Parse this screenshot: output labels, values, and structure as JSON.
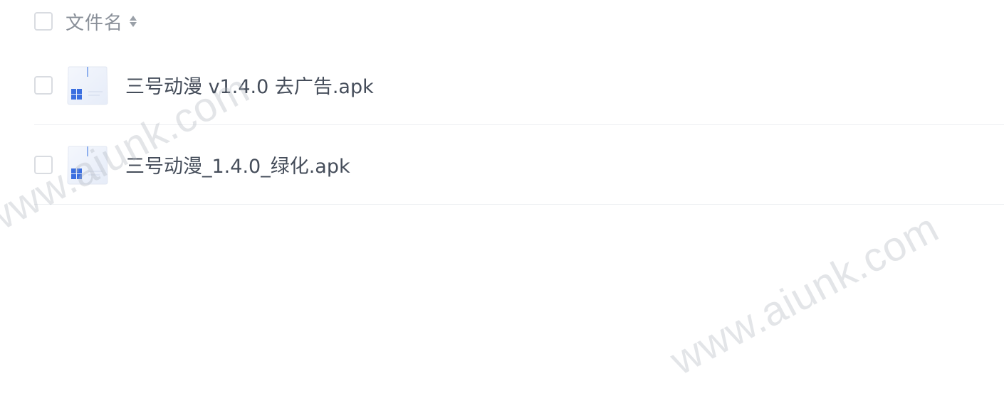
{
  "header": {
    "column_title": "文件名"
  },
  "files": [
    {
      "name": "三号动漫 v1.4.0 去广告.apk",
      "icon": "apk-file-icon"
    },
    {
      "name": "三号动漫_1.4.0_绿化.apk",
      "icon": "apk-file-icon"
    }
  ],
  "watermark": {
    "text": "www.aiunk.com"
  },
  "colors": {
    "text": "#454d5a",
    "header_text": "#8a9099",
    "checkbox_border": "#d9dce1",
    "row_divider": "#eef0f3",
    "icon_blue": "#3b6fe0"
  }
}
